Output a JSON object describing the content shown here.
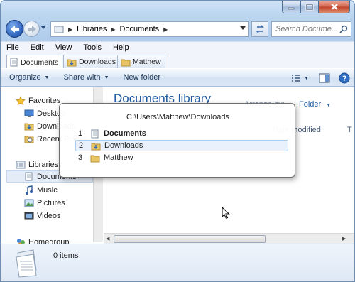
{
  "window": {
    "caption_buttons": [
      "minimize",
      "maximize",
      "close"
    ]
  },
  "nav": {
    "breadcrumb": [
      "Libraries",
      "Documents"
    ],
    "search_placeholder": "Search Docume..."
  },
  "menu": [
    "File",
    "Edit",
    "View",
    "Tools",
    "Help"
  ],
  "tabs": [
    {
      "label": "Documents",
      "active": true
    },
    {
      "label": "Downloads",
      "active": false
    },
    {
      "label": "Matthew",
      "active": false
    }
  ],
  "commands": {
    "organize": "Organize",
    "share_with": "Share with",
    "new_folder": "New folder"
  },
  "sidebar": {
    "favorites_label": "Favorites",
    "favorites": [
      "Desktop",
      "Downloads",
      "Recent Places"
    ],
    "libraries_label": "Libraries",
    "libraries": [
      "Documents",
      "Music",
      "Pictures",
      "Videos"
    ],
    "homegroup_label": "Homegroup"
  },
  "main": {
    "title": "Documents library",
    "arrange_by_label": "Arrange by:",
    "arrange_by_value": "Folder",
    "column_modified": "Date modified",
    "column_type": "T"
  },
  "details": {
    "count": "0 items"
  },
  "popup": {
    "path": "C:\\Users\\Matthew\\Downloads",
    "items": [
      {
        "num": "1",
        "label": "Documents",
        "bold": true,
        "selected": false
      },
      {
        "num": "2",
        "label": "Downloads",
        "bold": false,
        "selected": true
      },
      {
        "num": "3",
        "label": "Matthew",
        "bold": false,
        "selected": false
      }
    ]
  },
  "colors": {
    "accent": "#1e5aa0",
    "selection": "#e8f1fc",
    "folder": "#e8c564"
  }
}
